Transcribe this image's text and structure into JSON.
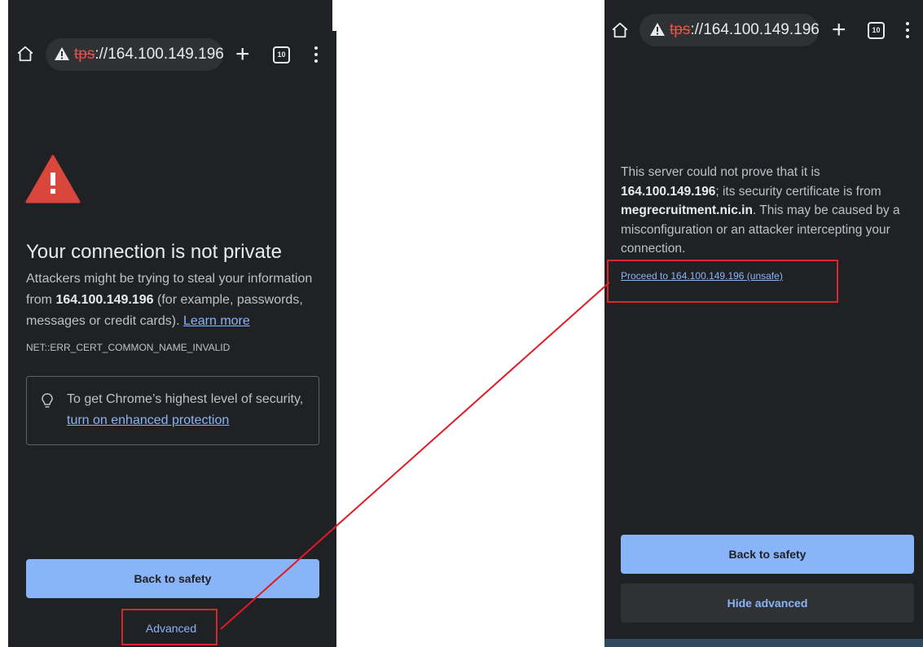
{
  "url": {
    "scheme_struck": "tps",
    "rest": "://164.100.149.196"
  },
  "tab_count": "10",
  "left": {
    "heading": "Your connection is not private",
    "para_pre": "Attackers might be trying to steal your information from ",
    "host": "164.100.149.196",
    "para_post": " (for example, passwords, messages or credit cards). ",
    "learn_more": "Learn more",
    "error_code": "NET::ERR_CERT_COMMON_NAME_INVALID",
    "tip_text": "To get Chrome’s highest level of security, ",
    "tip_link": "turn on enhanced protection",
    "back_to_safety": "Back to safety",
    "advanced": "Advanced"
  },
  "right": {
    "p1": "This server could not prove that it is ",
    "host": "164.100.149.196",
    "p2": "; its security certificate is from ",
    "cert_domain": "megrecruitment.nic.in",
    "p3": ". This may be caused by a misconfiguration or an attacker intercepting your connection.",
    "proceed_link": "Proceed to 164.100.149.196 (unsafe)",
    "back_to_safety": "Back to safety",
    "hide_advanced": "Hide advanced"
  },
  "colors": {
    "background": "#202124",
    "accent": "#8ab4f8",
    "warning_red": "#d9262b",
    "annotation_red": "#e01b24"
  },
  "icons": [
    "home-icon",
    "warning-icon",
    "plus-icon",
    "tabs-icon",
    "menu-icon",
    "error-triangle-icon",
    "lightbulb-icon"
  ]
}
